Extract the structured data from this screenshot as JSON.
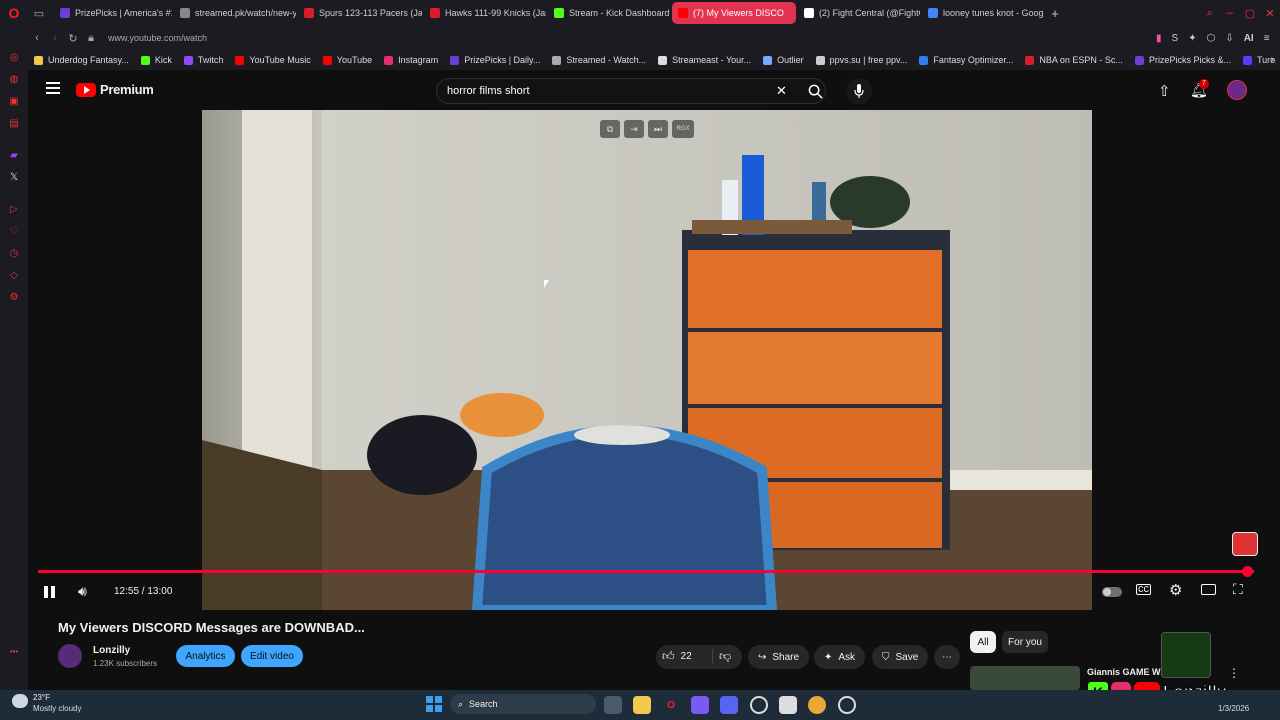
{
  "tabs": [
    {
      "label": "PrizePicks | America's #1",
      "color": "#6b3fd6"
    },
    {
      "label": "streamed.pk/watch/new-y",
      "color": "#888888"
    },
    {
      "label": "Spurs 123-113 Pacers (Jan",
      "color": "#d81e2e"
    },
    {
      "label": "Hawks 111-99 Knicks (Jan",
      "color": "#d81e2e"
    },
    {
      "label": "Stream - Kick Dashboard",
      "color": "#53fc18"
    },
    {
      "label": "(7) My Viewers DISCO",
      "color": "#ff0000"
    },
    {
      "label": "(2) Fight Central (@FightC",
      "color": "#ffffff"
    },
    {
      "label": "looney tunes knot - Googl",
      "color": "#4285f4"
    }
  ],
  "address": {
    "url": "www.youtube.com/watch",
    "ai_label": "AI"
  },
  "bookmarks": [
    {
      "label": "Underdog Fantasy...",
      "color": "#f2c94c"
    },
    {
      "label": "Kick",
      "color": "#53fc18"
    },
    {
      "label": "Twitch",
      "color": "#9146ff"
    },
    {
      "label": "YouTube Music",
      "color": "#ff0000"
    },
    {
      "label": "YouTube",
      "color": "#ff0000"
    },
    {
      "label": "Instagram",
      "color": "#e1306c"
    },
    {
      "label": "PrizePicks | Daily...",
      "color": "#6b3fd6"
    },
    {
      "label": "Streamed - Watch...",
      "color": "#aaaaaa"
    },
    {
      "label": "Streameast - Your...",
      "color": "#dddddd"
    },
    {
      "label": "Outlier",
      "color": "#7aa7ff"
    },
    {
      "label": "ppvs.su | free ppv...",
      "color": "#cccccc"
    },
    {
      "label": "Fantasy Optimizer...",
      "color": "#2f80ed"
    },
    {
      "label": "NBA on ESPN - Sc...",
      "color": "#d81e2e"
    },
    {
      "label": "PrizePicks Picks &...",
      "color": "#6b3fd6"
    },
    {
      "label": "Turo",
      "color": "#593cfb"
    }
  ],
  "youtube": {
    "logo_text": "Premium",
    "search_value": "horror films short",
    "notification_count": "7"
  },
  "player": {
    "time": "12:55 / 13:00",
    "progress": 0.994,
    "overlay_badge": "RGX"
  },
  "video": {
    "title": "My Viewers DISCORD Messages are DOWNBAD...",
    "channel": "Lonzilly",
    "subscribers": "1.23K subscribers",
    "analytics_label": "Analytics",
    "edit_label": "Edit video",
    "likes": "22",
    "share_label": "Share",
    "ask_label": "Ask",
    "save_label": "Save"
  },
  "chips": {
    "all": "All",
    "for_you": "For you"
  },
  "recommendation": {
    "title": "Giannis GAME WI"
  },
  "overlay_brand": "Lonzilly",
  "taskbar": {
    "temp": "23°F",
    "weather": "Mostly cloudy",
    "search_label": "Search",
    "date": "1/3/2026"
  }
}
